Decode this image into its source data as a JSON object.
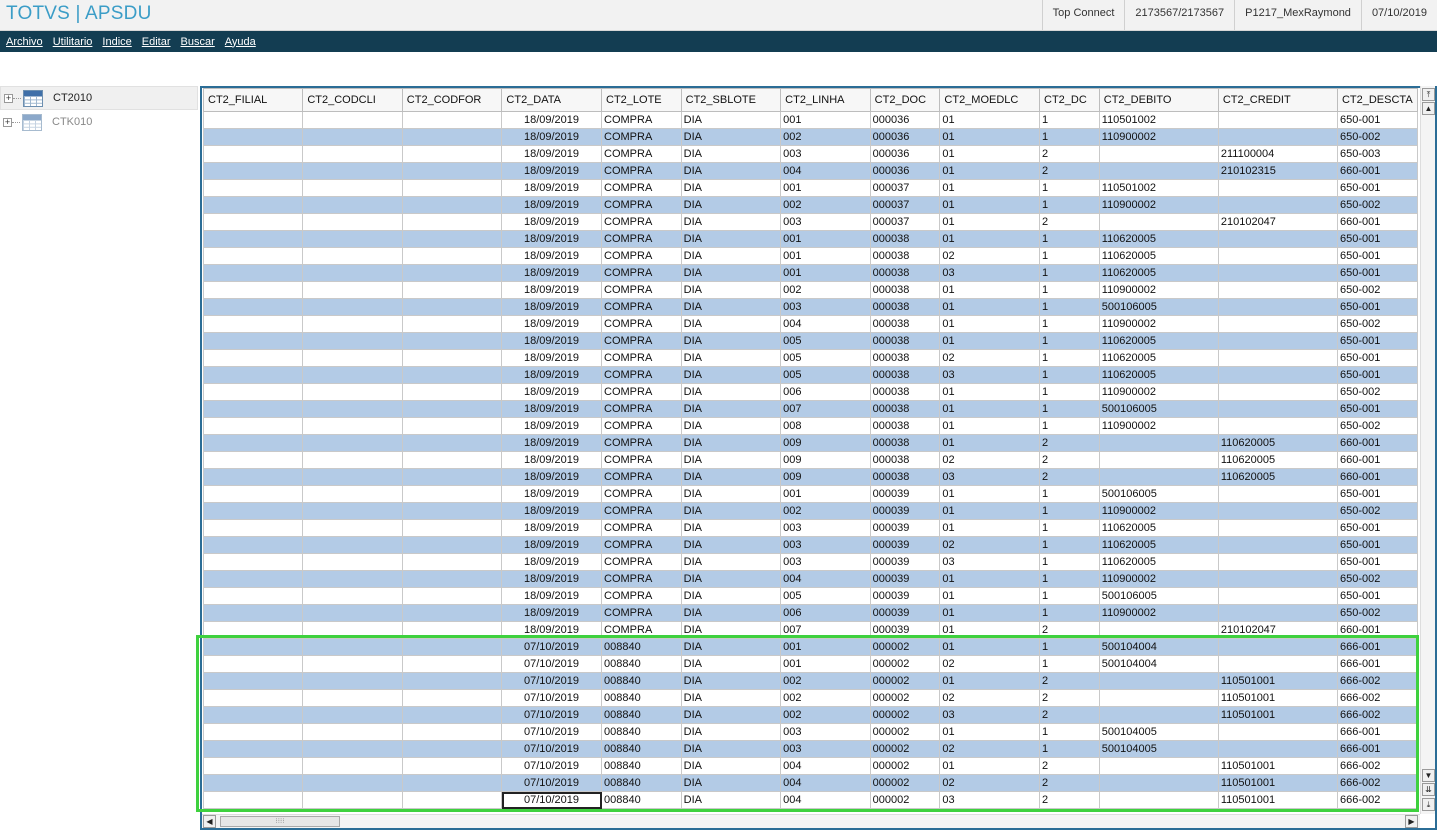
{
  "app": {
    "title": "TOTVS | APSDU"
  },
  "status": [
    "Top Connect",
    "2173567/2173567",
    "P1217_MexRaymond",
    "07/10/2019"
  ],
  "menu": [
    "Archivo",
    "Utilitario",
    "Indice",
    "Editar",
    "Buscar",
    "Ayuda"
  ],
  "tree": [
    {
      "label": "CT2010",
      "selected": true
    },
    {
      "label": "CTK010",
      "selected": false
    }
  ],
  "grid": {
    "columns": [
      "CT2_FILIAL",
      "CT2_CODCLI",
      "CT2_CODFOR",
      "CT2_DATA",
      "CT2_LOTE",
      "CT2_SBLOTE",
      "CT2_LINHA",
      "CT2_DOC",
      "CT2_MOEDLC",
      "CT2_DC",
      "CT2_DEBITO",
      "CT2_CREDIT",
      "CT2_DESCTA"
    ],
    "rows": [
      [
        "",
        "",
        "",
        "18/09/2019",
        "COMPRA",
        "DIA",
        "001",
        "000036",
        "01",
        "1",
        "110501002",
        "",
        "650-001"
      ],
      [
        "",
        "",
        "",
        "18/09/2019",
        "COMPRA",
        "DIA",
        "002",
        "000036",
        "01",
        "1",
        "110900002",
        "",
        "650-002"
      ],
      [
        "",
        "",
        "",
        "18/09/2019",
        "COMPRA",
        "DIA",
        "003",
        "000036",
        "01",
        "2",
        "",
        "211100004",
        "650-003"
      ],
      [
        "",
        "",
        "",
        "18/09/2019",
        "COMPRA",
        "DIA",
        "004",
        "000036",
        "01",
        "2",
        "",
        "210102315",
        "660-001"
      ],
      [
        "",
        "",
        "",
        "18/09/2019",
        "COMPRA",
        "DIA",
        "001",
        "000037",
        "01",
        "1",
        "110501002",
        "",
        "650-001"
      ],
      [
        "",
        "",
        "",
        "18/09/2019",
        "COMPRA",
        "DIA",
        "002",
        "000037",
        "01",
        "1",
        "110900002",
        "",
        "650-002"
      ],
      [
        "",
        "",
        "",
        "18/09/2019",
        "COMPRA",
        "DIA",
        "003",
        "000037",
        "01",
        "2",
        "",
        "210102047",
        "660-001"
      ],
      [
        "",
        "",
        "",
        "18/09/2019",
        "COMPRA",
        "DIA",
        "001",
        "000038",
        "01",
        "1",
        "110620005",
        "",
        "650-001"
      ],
      [
        "",
        "",
        "",
        "18/09/2019",
        "COMPRA",
        "DIA",
        "001",
        "000038",
        "02",
        "1",
        "110620005",
        "",
        "650-001"
      ],
      [
        "",
        "",
        "",
        "18/09/2019",
        "COMPRA",
        "DIA",
        "001",
        "000038",
        "03",
        "1",
        "110620005",
        "",
        "650-001"
      ],
      [
        "",
        "",
        "",
        "18/09/2019",
        "COMPRA",
        "DIA",
        "002",
        "000038",
        "01",
        "1",
        "110900002",
        "",
        "650-002"
      ],
      [
        "",
        "",
        "",
        "18/09/2019",
        "COMPRA",
        "DIA",
        "003",
        "000038",
        "01",
        "1",
        "500106005",
        "",
        "650-001"
      ],
      [
        "",
        "",
        "",
        "18/09/2019",
        "COMPRA",
        "DIA",
        "004",
        "000038",
        "01",
        "1",
        "110900002",
        "",
        "650-002"
      ],
      [
        "",
        "",
        "",
        "18/09/2019",
        "COMPRA",
        "DIA",
        "005",
        "000038",
        "01",
        "1",
        "110620005",
        "",
        "650-001"
      ],
      [
        "",
        "",
        "",
        "18/09/2019",
        "COMPRA",
        "DIA",
        "005",
        "000038",
        "02",
        "1",
        "110620005",
        "",
        "650-001"
      ],
      [
        "",
        "",
        "",
        "18/09/2019",
        "COMPRA",
        "DIA",
        "005",
        "000038",
        "03",
        "1",
        "110620005",
        "",
        "650-001"
      ],
      [
        "",
        "",
        "",
        "18/09/2019",
        "COMPRA",
        "DIA",
        "006",
        "000038",
        "01",
        "1",
        "110900002",
        "",
        "650-002"
      ],
      [
        "",
        "",
        "",
        "18/09/2019",
        "COMPRA",
        "DIA",
        "007",
        "000038",
        "01",
        "1",
        "500106005",
        "",
        "650-001"
      ],
      [
        "",
        "",
        "",
        "18/09/2019",
        "COMPRA",
        "DIA",
        "008",
        "000038",
        "01",
        "1",
        "110900002",
        "",
        "650-002"
      ],
      [
        "",
        "",
        "",
        "18/09/2019",
        "COMPRA",
        "DIA",
        "009",
        "000038",
        "01",
        "2",
        "",
        "110620005",
        "660-001"
      ],
      [
        "",
        "",
        "",
        "18/09/2019",
        "COMPRA",
        "DIA",
        "009",
        "000038",
        "02",
        "2",
        "",
        "110620005",
        "660-001"
      ],
      [
        "",
        "",
        "",
        "18/09/2019",
        "COMPRA",
        "DIA",
        "009",
        "000038",
        "03",
        "2",
        "",
        "110620005",
        "660-001"
      ],
      [
        "",
        "",
        "",
        "18/09/2019",
        "COMPRA",
        "DIA",
        "001",
        "000039",
        "01",
        "1",
        "500106005",
        "",
        "650-001"
      ],
      [
        "",
        "",
        "",
        "18/09/2019",
        "COMPRA",
        "DIA",
        "002",
        "000039",
        "01",
        "1",
        "110900002",
        "",
        "650-002"
      ],
      [
        "",
        "",
        "",
        "18/09/2019",
        "COMPRA",
        "DIA",
        "003",
        "000039",
        "01",
        "1",
        "110620005",
        "",
        "650-001"
      ],
      [
        "",
        "",
        "",
        "18/09/2019",
        "COMPRA",
        "DIA",
        "003",
        "000039",
        "02",
        "1",
        "110620005",
        "",
        "650-001"
      ],
      [
        "",
        "",
        "",
        "18/09/2019",
        "COMPRA",
        "DIA",
        "003",
        "000039",
        "03",
        "1",
        "110620005",
        "",
        "650-001"
      ],
      [
        "",
        "",
        "",
        "18/09/2019",
        "COMPRA",
        "DIA",
        "004",
        "000039",
        "01",
        "1",
        "110900002",
        "",
        "650-002"
      ],
      [
        "",
        "",
        "",
        "18/09/2019",
        "COMPRA",
        "DIA",
        "005",
        "000039",
        "01",
        "1",
        "500106005",
        "",
        "650-001"
      ],
      [
        "",
        "",
        "",
        "18/09/2019",
        "COMPRA",
        "DIA",
        "006",
        "000039",
        "01",
        "1",
        "110900002",
        "",
        "650-002"
      ],
      [
        "",
        "",
        "",
        "18/09/2019",
        "COMPRA",
        "DIA",
        "007",
        "000039",
        "01",
        "2",
        "",
        "210102047",
        "660-001"
      ],
      [
        "",
        "",
        "",
        "07/10/2019",
        "008840",
        "DIA",
        "001",
        "000002",
        "01",
        "1",
        "500104004",
        "",
        "666-001"
      ],
      [
        "",
        "",
        "",
        "07/10/2019",
        "008840",
        "DIA",
        "001",
        "000002",
        "02",
        "1",
        "500104004",
        "",
        "666-001"
      ],
      [
        "",
        "",
        "",
        "07/10/2019",
        "008840",
        "DIA",
        "002",
        "000002",
        "01",
        "2",
        "",
        "110501001",
        "666-002"
      ],
      [
        "",
        "",
        "",
        "07/10/2019",
        "008840",
        "DIA",
        "002",
        "000002",
        "02",
        "2",
        "",
        "110501001",
        "666-002"
      ],
      [
        "",
        "",
        "",
        "07/10/2019",
        "008840",
        "DIA",
        "002",
        "000002",
        "03",
        "2",
        "",
        "110501001",
        "666-002"
      ],
      [
        "",
        "",
        "",
        "07/10/2019",
        "008840",
        "DIA",
        "003",
        "000002",
        "01",
        "1",
        "500104005",
        "",
        "666-001"
      ],
      [
        "",
        "",
        "",
        "07/10/2019",
        "008840",
        "DIA",
        "003",
        "000002",
        "02",
        "1",
        "500104005",
        "",
        "666-001"
      ],
      [
        "",
        "",
        "",
        "07/10/2019",
        "008840",
        "DIA",
        "004",
        "000002",
        "01",
        "2",
        "",
        "110501001",
        "666-002"
      ],
      [
        "",
        "",
        "",
        "07/10/2019",
        "008840",
        "DIA",
        "004",
        "000002",
        "02",
        "2",
        "",
        "110501001",
        "666-002"
      ],
      [
        "",
        "",
        "",
        "07/10/2019",
        "008840",
        "DIA",
        "004",
        "000002",
        "03",
        "2",
        "",
        "110501001",
        "666-002"
      ]
    ]
  },
  "colors": {
    "title": "#3b9dc7",
    "menu_bg": "#133d52",
    "row_alt": "#b3cbe6",
    "highlight": "#3ed13e",
    "panel_border": "#2b6d96"
  }
}
